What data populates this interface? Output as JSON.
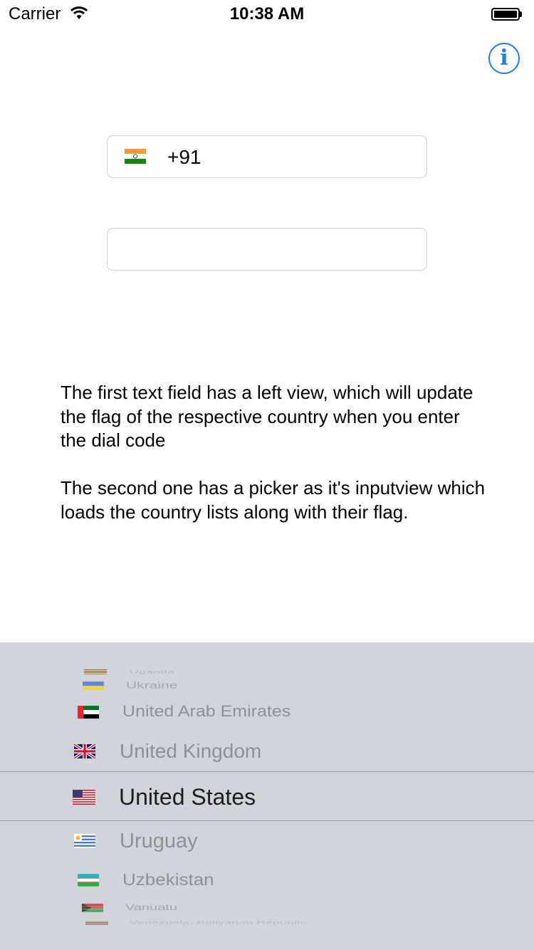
{
  "status_bar": {
    "carrier": "Carrier",
    "time": "10:38 AM"
  },
  "header": {
    "info_icon": "info-circle-icon",
    "accent_color": "#1a7cf6"
  },
  "form": {
    "dial_code_field": {
      "value": "+91",
      "flag": "india-flag-icon"
    },
    "country_field": {
      "value": ""
    }
  },
  "description": {
    "paragraph_1": "The first text field has a left view, which will update the flag of the respective country when you enter the dial code",
    "paragraph_2": "The second one has a picker as it's inputview which loads the country lists along with their flag."
  },
  "picker": {
    "background": "#d1d4da",
    "selected": "United States",
    "rows": [
      {
        "label": "Uganda",
        "flag": "uganda-flag-icon"
      },
      {
        "label": "Ukraine",
        "flag": "ukraine-flag-icon"
      },
      {
        "label": "United Arab Emirates",
        "flag": "uae-flag-icon"
      },
      {
        "label": "United Kingdom",
        "flag": "uk-flag-icon"
      },
      {
        "label": "United States",
        "flag": "us-flag-icon"
      },
      {
        "label": "Uruguay",
        "flag": "uruguay-flag-icon"
      },
      {
        "label": "Uzbekistan",
        "flag": "uzbekistan-flag-icon"
      },
      {
        "label": "Vanuatu",
        "flag": "vanuatu-flag-icon"
      },
      {
        "label": "Venezuela, Bolivarian Republic",
        "flag": "venezuela-flag-icon"
      }
    ]
  }
}
